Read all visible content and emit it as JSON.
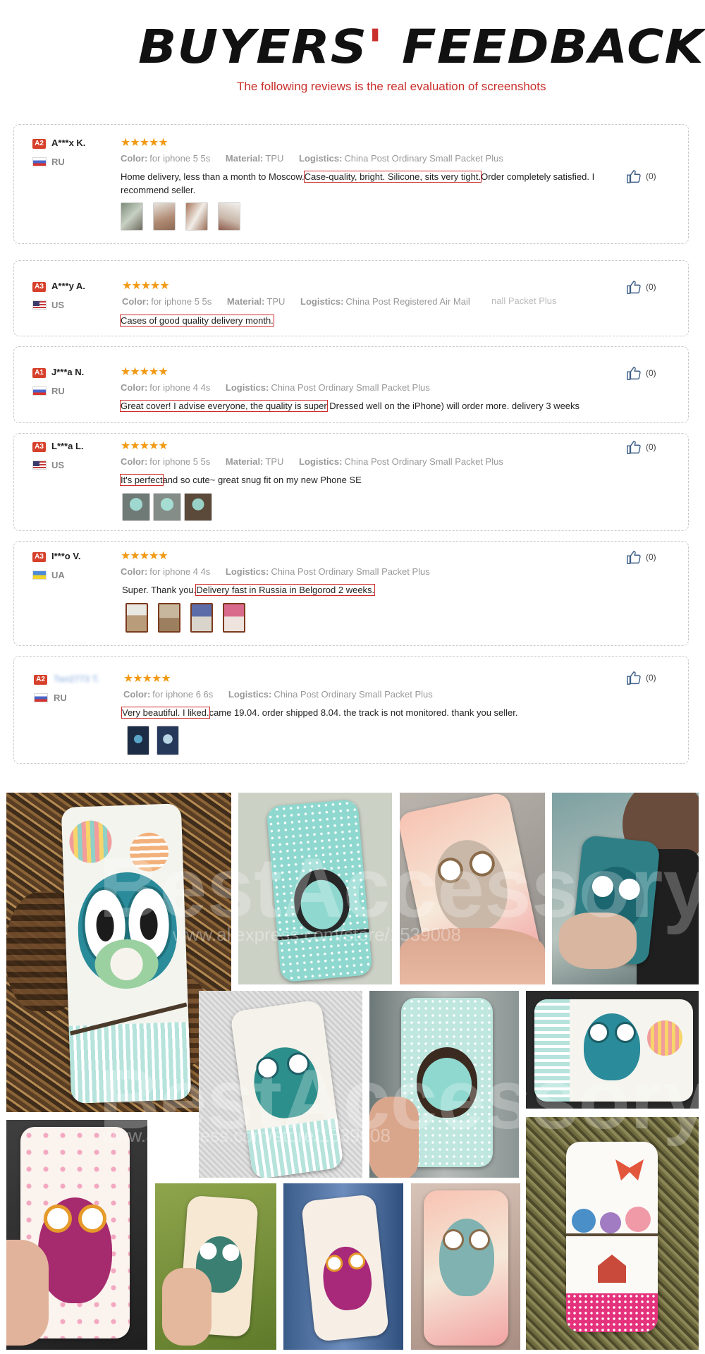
{
  "header": {
    "title_left": "BUYERS",
    "title_apostrophe": "'",
    "title_right": " FEEDBACK",
    "subtitle": "The following reviews is the real evaluation of screenshots"
  },
  "stars": "★★★★★",
  "labels": {
    "color": "Color:",
    "material": "Material:",
    "logistics": "Logistics:"
  },
  "reviews": [
    {
      "level": "A2",
      "name": "A***x K.",
      "country": "RU",
      "color": "for iphone 5 5s",
      "material": "TPU",
      "logistics": "China Post Ordinary Small Packet Plus",
      "text_before": "Home delivery, less than a month to Moscow.",
      "text_highlight": "Case-quality, bright. Silicone, sits very tight.",
      "text_after": "Order completely satisfied. I recommend seller.",
      "likes": "(0)"
    },
    {
      "level": "A3",
      "name": "A***y A.",
      "country": "US",
      "color": "for iphone 5 5s",
      "material": "TPU",
      "logistics": "China Post Registered Air Mail",
      "faded": "nall Packet Plus",
      "text_before": "",
      "text_highlight": "Cases of good quality delivery month.",
      "text_after": "",
      "likes": "(0)"
    },
    {
      "level": "A1",
      "name": "J***a N.",
      "country": "RU",
      "color": "for iphone 4 4s",
      "logistics": "China Post Ordinary Small Packet Plus",
      "text_before": "",
      "text_highlight": "Great cover! I advise everyone, the quality is super",
      "text_after": " Dressed well on the iPhone) will order more. delivery 3 weeks",
      "likes": "(0)"
    },
    {
      "level": "A3",
      "name": "L***a L.",
      "country": "US",
      "color": "for iphone 5 5s",
      "material": "TPU",
      "logistics": "China Post Ordinary Small Packet Plus",
      "text_before": "",
      "text_highlight": "It's perfect",
      "text_after": "and so cute~ great snug fit on my new  Phone SE",
      "likes": "(0)"
    },
    {
      "level": "A3",
      "name": "I***o V.",
      "country": "UA",
      "color": "for iphone 4 4s",
      "logistics": "China Post Ordinary Small Packet Plus",
      "text_before": "Super. Thank you.",
      "text_highlight": "Delivery fast in Russia in Belgorod 2 weeks.",
      "text_after": "",
      "likes": "(0)"
    },
    {
      "level": "A2",
      "name": "Tan2773 T.",
      "country": "RU",
      "color": "for iphone 6 6s",
      "logistics": "China Post Ordinary Small Packet Plus",
      "text_before": "",
      "text_highlight": "Very beautiful. I liked.",
      "text_after": "came 19.04. order shipped 8.04. the track is not monitored. thank you seller.",
      "likes": "(0)"
    }
  ],
  "gallery": {
    "watermark": "BestAccessory",
    "watermark_url": "www.aliexpress.com/store/1539008"
  },
  "colors": {
    "accent_red": "#cf2b2b",
    "star_orange": "#f19a14",
    "badge_red": "#d6402a",
    "case_mint": "#8fd8cf"
  }
}
